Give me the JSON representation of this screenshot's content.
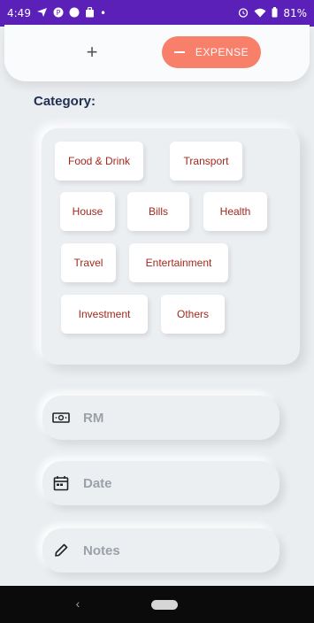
{
  "status_bar": {
    "time": "4:49",
    "battery": "81%",
    "dot": "•",
    "left_icons": [
      "navigation-arrow-icon",
      "app-notification-icon",
      "circle-icon",
      "bag-icon"
    ],
    "right_icons": [
      "alarm-icon",
      "wifi-icon",
      "battery-icon"
    ]
  },
  "header": {
    "add_label": "+",
    "expense_label": "EXPENSE",
    "expense_color": "#f87f6a"
  },
  "category": {
    "heading": "Category:",
    "text_color": "#a1291f",
    "items": [
      "Food & Drink",
      "Transport",
      "House",
      "Bills",
      "Health",
      "Travel",
      "Entertainment",
      "Investment",
      "Others"
    ]
  },
  "form": {
    "amount_placeholder": "RM",
    "date_placeholder": "Date",
    "notes_placeholder": "Notes",
    "amount_icon": "money-icon",
    "date_icon": "calendar-icon",
    "notes_icon": "pencil-icon"
  },
  "nav": {
    "back_icon": "back-icon",
    "back_glyph": "‹",
    "home_icon": "home-pill"
  },
  "colors": {
    "status_bar": "#5a20b8",
    "background": "#ebeef1",
    "heading": "#213050"
  }
}
